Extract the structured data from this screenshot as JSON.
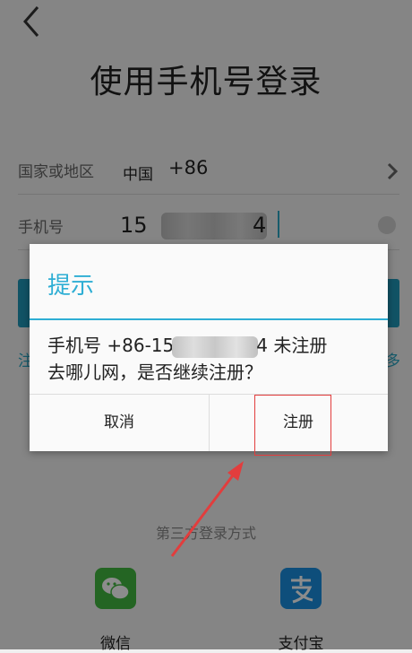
{
  "header": {
    "title": "使用手机号登录"
  },
  "form": {
    "country_label": "国家或地区",
    "country_name": "中国",
    "country_code": "+86",
    "phone_label": "手机号",
    "phone_prefix": "15",
    "phone_suffix": "4"
  },
  "third_party": {
    "title": "第三方登录方式",
    "items": [
      {
        "label": "微信",
        "icon": "wechat-icon"
      },
      {
        "label": "支付宝",
        "icon": "alipay-icon"
      }
    ]
  },
  "dialog": {
    "title": "提示",
    "message_line1_prefix": "手机号 +86-15",
    "message_line1_suffix": "4 未注册",
    "message_line2": "去哪儿网，是否继续注册？",
    "cancel_label": "取消",
    "register_label": "注册"
  },
  "colors": {
    "accent": "#2eaed4",
    "primary_button": "#1f98b9",
    "annotation": "#e23d3d"
  }
}
